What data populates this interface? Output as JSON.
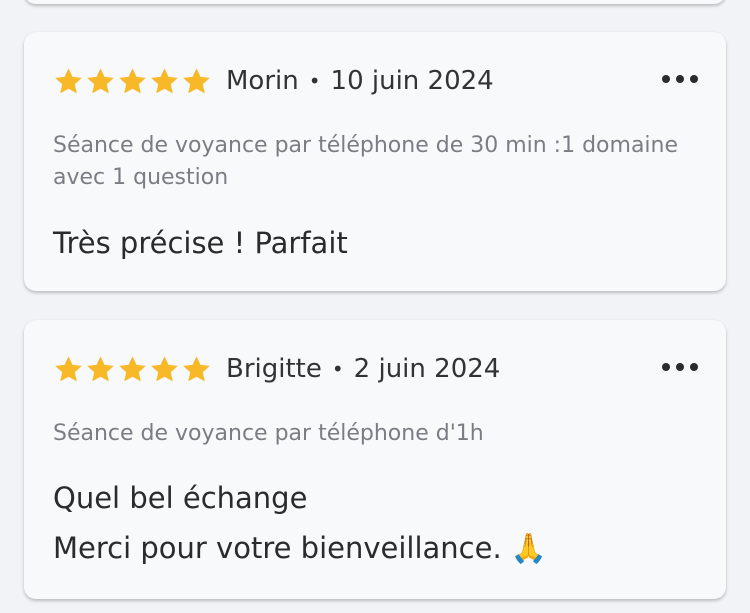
{
  "colors": {
    "star": "#f7b928",
    "background": "#f2f3f6",
    "card": "#f8f9fb",
    "muted_text": "#7a7d83"
  },
  "reviews": [
    {
      "rating": 5,
      "author": "Morin",
      "separator": "•",
      "date": "10 juin 2024",
      "service": "Séance de voyance par téléphone de 30 min :1 domaine avec 1 question",
      "text": "Très précise ! Parfait",
      "more_icon": "more-horizontal-icon"
    },
    {
      "rating": 5,
      "author": "Brigitte",
      "separator": "•",
      "date": "2 juin 2024",
      "service": "Séance de voyance par téléphone d'1h",
      "text": "Quel bel échange\n Merci pour votre bienveillance. 🙏",
      "more_icon": "more-horizontal-icon"
    }
  ]
}
